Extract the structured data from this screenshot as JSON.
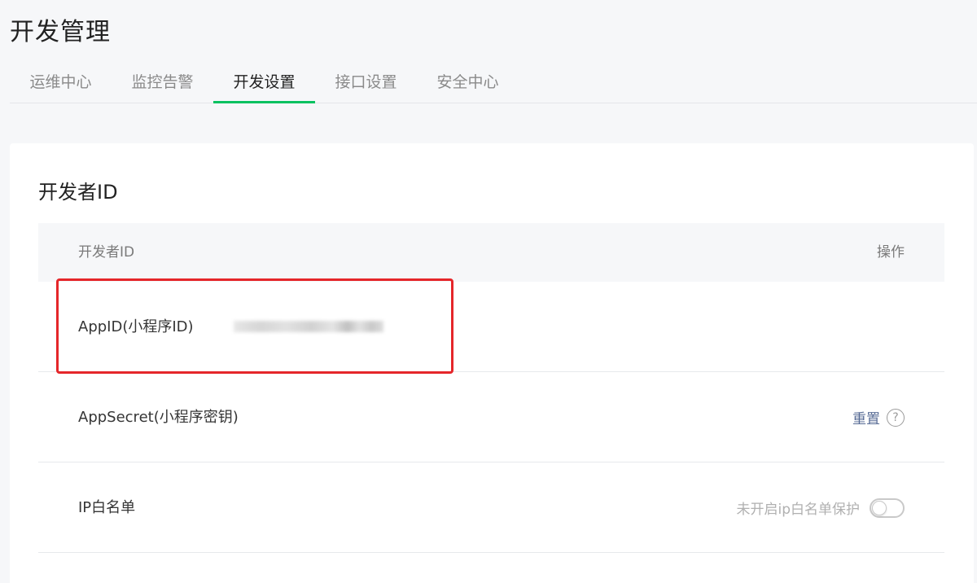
{
  "page": {
    "title": "开发管理"
  },
  "tabs": [
    {
      "label": "运维中心",
      "active": false
    },
    {
      "label": "监控告警",
      "active": false
    },
    {
      "label": "开发设置",
      "active": true
    },
    {
      "label": "接口设置",
      "active": false
    },
    {
      "label": "安全中心",
      "active": false
    }
  ],
  "section": {
    "title": "开发者ID",
    "table": {
      "header": {
        "left": "开发者ID",
        "right": "操作"
      },
      "rows": [
        {
          "label": "AppID(小程序ID)",
          "value_obscured": true
        },
        {
          "label": "AppSecret(小程序密钥)",
          "action": "重置",
          "help_icon": "question-circle-icon"
        },
        {
          "label": "IP白名单",
          "status": "未开启ip白名单保护",
          "toggle_on": false
        }
      ]
    }
  },
  "colors": {
    "accent": "#07c160",
    "link": "#576b95",
    "highlight_box": "#e5262a",
    "background": "#f6f7f9"
  }
}
